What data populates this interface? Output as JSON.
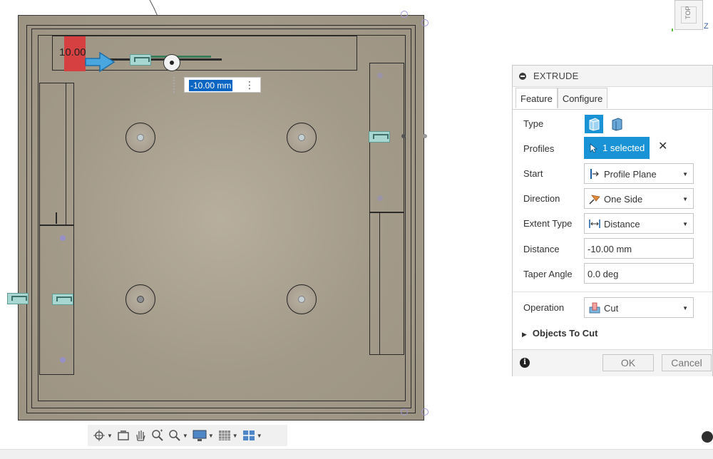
{
  "manipulator": {
    "dimension_text": "10.00",
    "input_value": "-10.00 mm",
    "menu_glyph": "⋮"
  },
  "viewcube": {
    "face": "TOP",
    "axis_z": "Z"
  },
  "navbar": {
    "icons": [
      "orbit-icon",
      "look-at-icon",
      "pan-icon",
      "zoom-icon",
      "zoom-window-icon",
      "display-settings-icon",
      "grid-icon",
      "viewports-icon"
    ]
  },
  "extrude": {
    "title": "EXTRUDE",
    "tabs": [
      {
        "label": "Feature",
        "active": true
      },
      {
        "label": "Configure",
        "active": false
      }
    ],
    "rows": {
      "type": {
        "label": "Type"
      },
      "profiles": {
        "label": "Profiles",
        "value": "1 selected",
        "clear": "✕"
      },
      "start": {
        "label": "Start",
        "value": "Profile Plane"
      },
      "direction": {
        "label": "Direction",
        "value": "One Side"
      },
      "extent_type": {
        "label": "Extent Type",
        "value": "Distance"
      },
      "distance": {
        "label": "Distance",
        "value": "-10.00 mm"
      },
      "taper_angle": {
        "label": "Taper Angle",
        "value": "0.0 deg"
      },
      "operation": {
        "label": "Operation",
        "value": "Cut"
      }
    },
    "objects_to_cut": "Objects To Cut",
    "info": "i",
    "ok_label": "OK",
    "cancel_label": "Cancel"
  },
  "colors": {
    "accent": "#1a93d6",
    "model_fill": "#a39a89",
    "selection_red": "#d64040",
    "highlight": "#0b66c3"
  }
}
